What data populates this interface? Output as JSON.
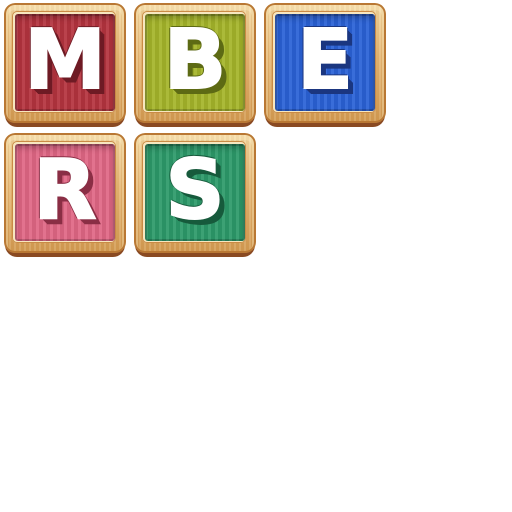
{
  "tiles": [
    {
      "letter": "M",
      "color": "#b5343f",
      "shadow": "#6e1b24"
    },
    {
      "letter": "B",
      "color": "#a5b52a",
      "shadow": "#5d6a14"
    },
    {
      "letter": "E",
      "color": "#2a62d6",
      "shadow": "#1b3680"
    },
    {
      "letter": "R",
      "color": "#e06785",
      "shadow": "#8a2e45"
    },
    {
      "letter": "S",
      "color": "#2d9a6a",
      "shadow": "#175a3c"
    }
  ]
}
